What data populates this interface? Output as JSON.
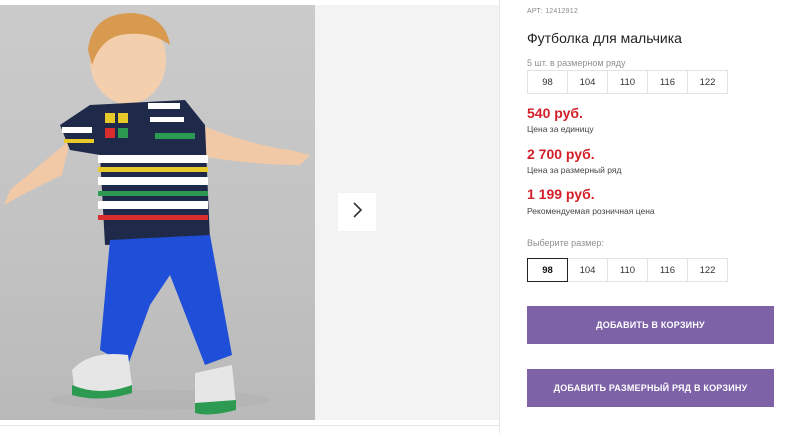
{
  "gallery": {
    "image_alt": "boy-in-striped-tshirt-and-blue-pants",
    "next_icon": "chevron-right-icon"
  },
  "product": {
    "article": "АРТ: 12412912",
    "title": "Футболка для мальчика"
  },
  "size_run": {
    "hint": "5 шт. в размерном ряду",
    "sizes": [
      "98",
      "104",
      "110",
      "116",
      "122"
    ]
  },
  "prices": [
    {
      "value": "540 руб.",
      "label": "Цена за единицу"
    },
    {
      "value": "2 700 руб.",
      "label": "Цена за размерный ряд"
    },
    {
      "value": "1 199 руб.",
      "label": "Рекомендуемая розничная цена"
    }
  ],
  "size_select": {
    "label": "Выберите размер:",
    "sizes": [
      "98",
      "104",
      "110",
      "116",
      "122"
    ],
    "selected": "98"
  },
  "buttons": {
    "add_to_cart": "ДОБАВИТЬ В КОРЗИНУ",
    "add_size_run": "ДОБАВИТЬ РАЗМЕРНЫЙ РЯД В КОРЗИНУ"
  },
  "colors": {
    "price": "#d3202a",
    "button": "#7d62a8"
  }
}
